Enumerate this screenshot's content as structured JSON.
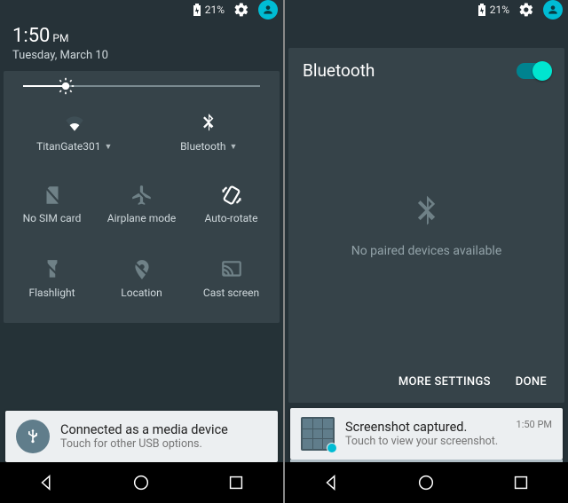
{
  "left": {
    "status": {
      "battery": "21%"
    },
    "clock": {
      "time": "1:50",
      "ampm": "PM",
      "date": "Tuesday, March 10"
    },
    "tiles": {
      "wifi_label": "TitanGate301",
      "bt_label": "Bluetooth",
      "sim_label": "No SIM card",
      "airplane_label": "Airplane mode",
      "rotate_label": "Auto-rotate",
      "flash_label": "Flashlight",
      "location_label": "Location",
      "cast_label": "Cast screen"
    },
    "notification": {
      "title": "Connected as a media device",
      "sub": "Touch for other USB options."
    }
  },
  "right": {
    "status": {
      "battery": "21%"
    },
    "header": "Bluetooth",
    "empty_msg": "No paired devices available",
    "actions": {
      "more": "MORE SETTINGS",
      "done": "DONE"
    },
    "notification": {
      "title": "Screenshot captured.",
      "sub": "Touch to view your screenshot.",
      "time": "1:50 PM"
    }
  }
}
